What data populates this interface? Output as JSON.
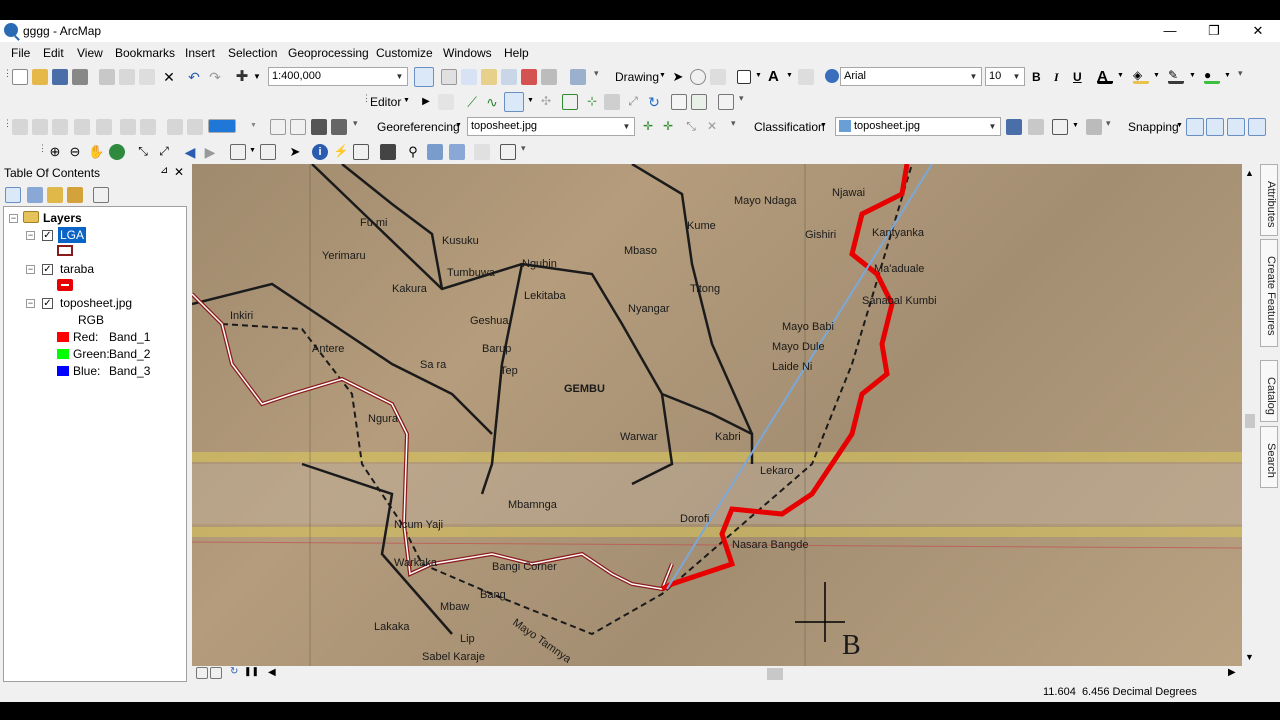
{
  "window": {
    "title": "gggg - ArcMap",
    "minimize": "—",
    "restore": "❐",
    "close": "✕"
  },
  "menu": [
    "File",
    "Edit",
    "View",
    "Bookmarks",
    "Insert",
    "Selection",
    "Geoprocessing",
    "Customize",
    "Windows",
    "Help"
  ],
  "toolbar": {
    "scale": "1:400,000",
    "drawing_label": "Drawing",
    "font": "Arial",
    "font_size": "10",
    "bold": "B",
    "italic": "I",
    "underline": "U",
    "text_tool": "A",
    "editor_label": "Editor",
    "georeferencing_label": "Georeferencing",
    "georef_layer": "toposheet.jpg",
    "classification_label": "Classification",
    "classification_layer": "toposheet.jpg",
    "snapping_label": "Snapping"
  },
  "toc": {
    "title": "Table Of Contents",
    "pin": "📌",
    "close": "✕",
    "root": "Layers",
    "layers": [
      {
        "name": "LGA",
        "checked": true,
        "selected": true
      },
      {
        "name": "taraba",
        "checked": true,
        "selected": false
      },
      {
        "name": "toposheet.jpg",
        "checked": true,
        "selected": false
      }
    ],
    "raster_legend": {
      "title": "RGB",
      "bands": [
        {
          "label": "Red:",
          "band": "Band_1",
          "color": "#ff0000"
        },
        {
          "label": "Green:",
          "band": "Band_2",
          "color": "#00ff00"
        },
        {
          "label": "Blue:",
          "band": "Band_3",
          "color": "#0000ff"
        }
      ]
    }
  },
  "map_labels": [
    "Njawai",
    "Mayo Ndaga",
    "Fu mi",
    "Kusuku",
    "Kume",
    "Gishiri",
    "Kantyanka",
    "Yerimaru",
    "Tumbuwa",
    "Ngubin",
    "Mbaso",
    "Ma'aduale",
    "Kakura",
    "Lekitaba",
    "Titong",
    "Sanabal Kumbi",
    "Inkiri",
    "Geshua",
    "Nyangar",
    "Mayo Babi",
    "Antere",
    "Barup",
    "Mayo Dule",
    "Sa ra",
    "Tep",
    "Laide Ni",
    "GEMBU",
    "Ngura",
    "Warwar",
    "Kabri",
    "Lekaro",
    "Mbamnga",
    "Dorofi",
    "Ncum Yaji",
    "Nasara Bangde",
    "Warkaka",
    "Bangi Corner",
    "Bang",
    "Mbaw",
    "Lakaka",
    "Lip",
    "Sabel Karaje",
    "Mayo Tamnya",
    "B"
  ],
  "dock": [
    "Attributes",
    "Create Features",
    "Catalog",
    "Search"
  ],
  "status": {
    "coords": "11.604  6.456 Decimal Degrees"
  },
  "colors": {
    "taraba_boundary": "#e60000",
    "lga_outline": "#8b1a1a",
    "selection_blue": "#0a64c8"
  }
}
